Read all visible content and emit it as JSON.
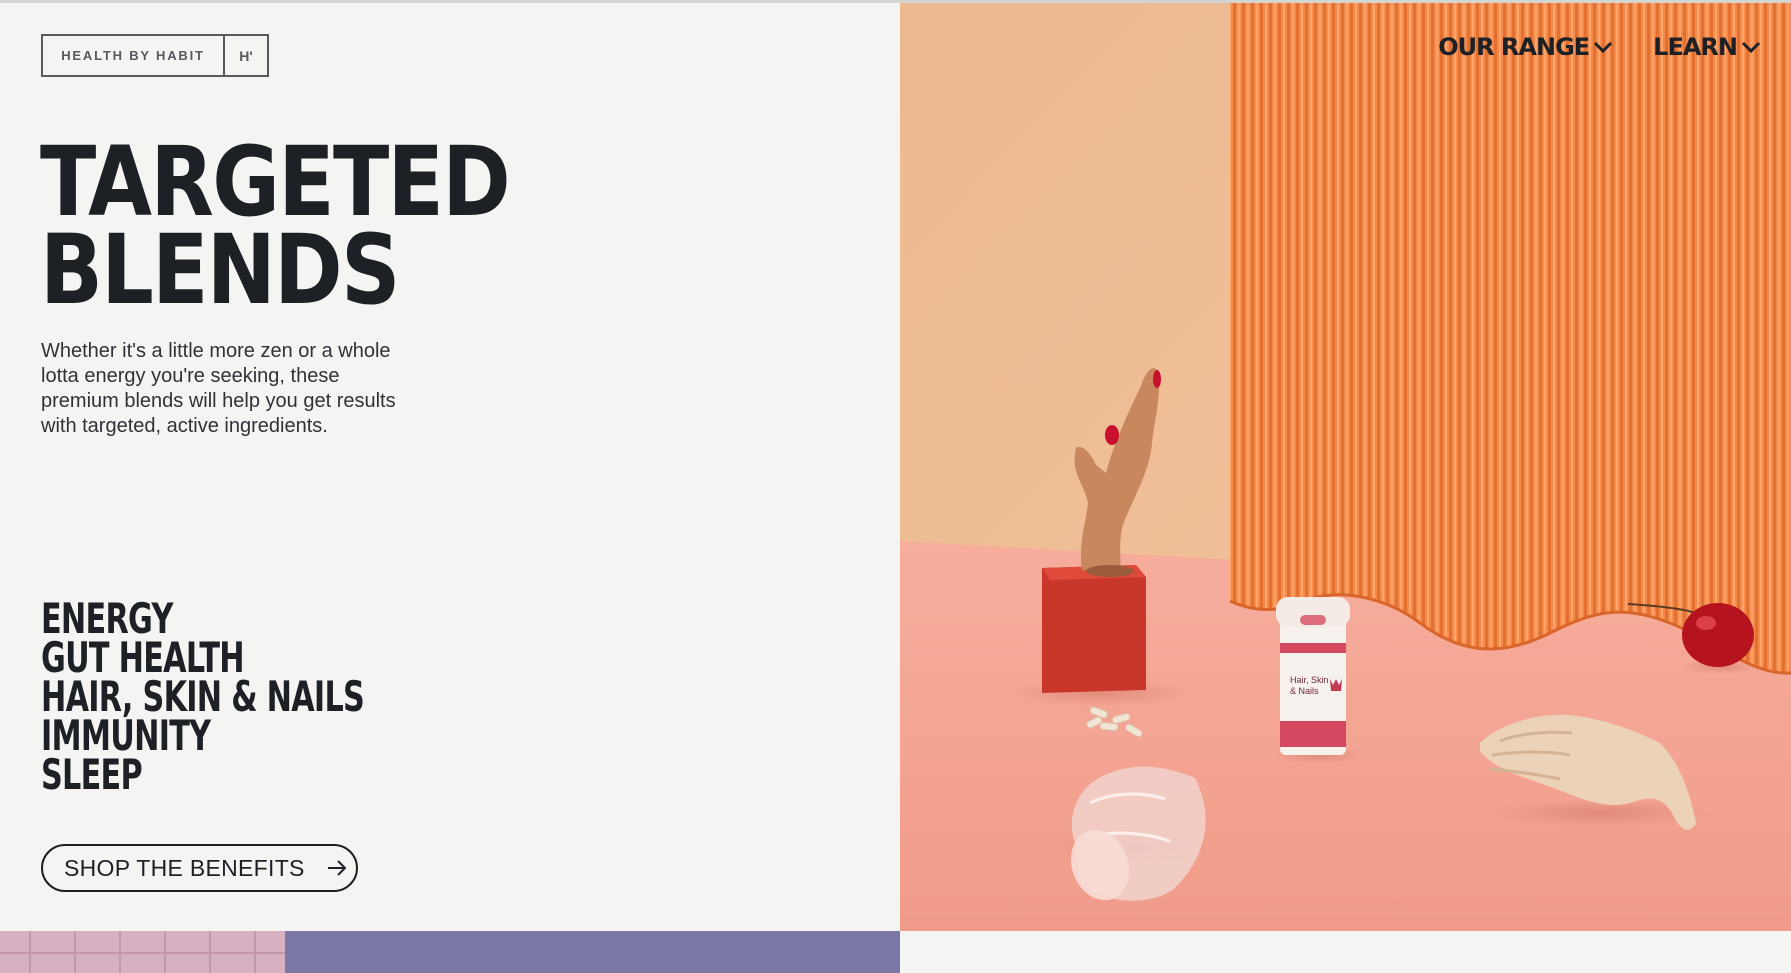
{
  "brand": {
    "name": "HEALTH BY HABIT",
    "mark": "H'"
  },
  "nav": {
    "items": [
      {
        "label": "OUR RANGE",
        "icon": "chevron-down-icon"
      },
      {
        "label": "LEARN",
        "icon": "chevron-down-icon"
      }
    ]
  },
  "hero": {
    "title_line1": "TARGETED",
    "title_line2": "BLENDS",
    "description": "Whether it's a little more zen or a whole lotta energy you're seeking, these premium blends will help you get results with targeted, active ingredients."
  },
  "benefits": {
    "items": [
      "ENERGY",
      "GUT HEALTH",
      "HAIR, SKIN & NAILS",
      "IMMUNITY",
      "SLEEP"
    ]
  },
  "cta": {
    "label": "SHOP THE BENEFITS",
    "icon": "arrow-right-icon"
  },
  "product": {
    "label_line1": "Hair, Skin",
    "label_line2": "& Nails"
  },
  "colors": {
    "background": "#f4f4f2",
    "text": "#1d2126",
    "accent_orange": "#f58a4c",
    "floor_pink": "#f3a394",
    "wall_peach": "#f0ba92",
    "block_red": "#c9362a"
  }
}
